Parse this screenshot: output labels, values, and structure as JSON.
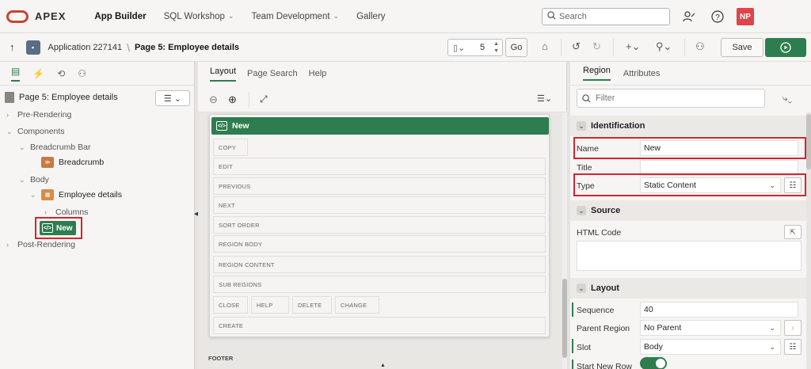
{
  "topnav": {
    "brand": "APEX",
    "items": [
      {
        "label": "App Builder",
        "active": true
      },
      {
        "label": "SQL Workshop",
        "active": false
      },
      {
        "label": "Team Development",
        "active": false
      },
      {
        "label": "Gallery",
        "active": false
      }
    ],
    "search_placeholder": "Search",
    "avatar_initials": "NP"
  },
  "toolbar": {
    "app_label": "Application 227141",
    "page_label": "Page 5: Employee details",
    "page_number": "5",
    "go_label": "Go",
    "save_label": "Save"
  },
  "left": {
    "page_node": "Page 5: Employee details",
    "tree": {
      "pre_rendering": "Pre-Rendering",
      "components": "Components",
      "breadcrumb_bar": "Breadcrumb Bar",
      "breadcrumb": "Breadcrumb",
      "body": "Body",
      "employee_details": "Employee details",
      "columns": "Columns",
      "new": "New",
      "post_rendering": "Post-Rendering"
    }
  },
  "center": {
    "tabs": [
      "Layout",
      "Page Search",
      "Help"
    ],
    "region_title": "New",
    "slots": {
      "copy": "COPY",
      "edit": "EDIT",
      "previous": "PREVIOUS",
      "next": "NEXT",
      "sort_order": "SORT ORDER",
      "region_body": "REGION BODY",
      "region_content": "REGION CONTENT",
      "sub_regions": "SUB REGIONS",
      "close": "CLOSE",
      "help": "HELP",
      "delete": "DELETE",
      "change": "CHANGE",
      "create": "CREATE"
    },
    "footer": "FOOTER"
  },
  "right": {
    "tabs": [
      "Region",
      "Attributes"
    ],
    "filter_placeholder": "Filter",
    "identification": {
      "heading": "Identification",
      "name_label": "Name",
      "name_value": "New",
      "title_label": "Title",
      "title_value": "",
      "type_label": "Type",
      "type_value": "Static Content"
    },
    "source": {
      "heading": "Source",
      "html_label": "HTML Code"
    },
    "layout": {
      "heading": "Layout",
      "sequence_label": "Sequence",
      "sequence_value": "40",
      "parent_label": "Parent Region",
      "parent_value": "No Parent",
      "slot_label": "Slot",
      "slot_value": "Body",
      "start_new_row_label": "Start New Row"
    }
  },
  "colors": {
    "accent_green": "#2e7d4f",
    "highlight_red": "#d6242f",
    "brand_red": "#c74634"
  }
}
